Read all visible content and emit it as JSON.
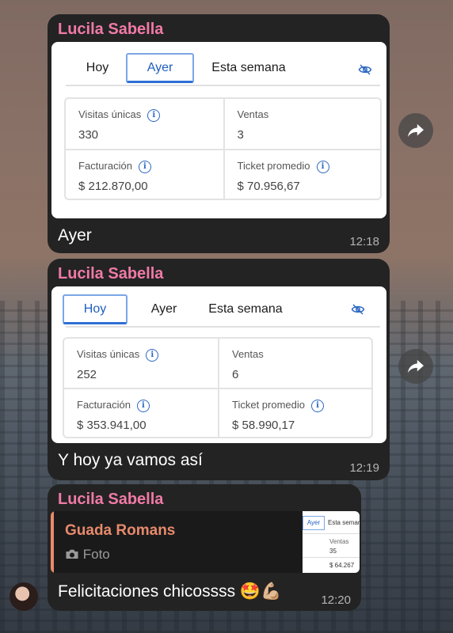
{
  "messages": [
    {
      "sender": "Lucila Sabella",
      "tabs": [
        "Hoy",
        "Ayer",
        "Esta semana"
      ],
      "active_tab": "Ayer",
      "stats": {
        "visitas_label": "Visitas únicas",
        "visitas_value": "330",
        "ventas_label": "Ventas",
        "ventas_value": "3",
        "facturacion_label": "Facturación",
        "facturacion_value": "$ 212.870,00",
        "ticket_label": "Ticket promedio",
        "ticket_value": "$ 70.956,67"
      },
      "text": "Ayer",
      "time": "12:18"
    },
    {
      "sender": "Lucila Sabella",
      "tabs": [
        "Hoy",
        "Ayer",
        "Esta semana"
      ],
      "active_tab": "Hoy",
      "stats": {
        "visitas_label": "Visitas únicas",
        "visitas_value": "252",
        "ventas_label": "Ventas",
        "ventas_value": "6",
        "facturacion_label": "Facturación",
        "facturacion_value": "$ 353.941,00",
        "ticket_label": "Ticket promedio",
        "ticket_value": "$ 58.990,17"
      },
      "text": "Y hoy ya vamos así",
      "time": "12:19"
    },
    {
      "sender": "Lucila Sabella",
      "reply_to": {
        "name": "Guada Romans",
        "subtitle": "Foto",
        "thumb_tab_a": "Ayer",
        "thumb_tab_b": "Esta semana",
        "thumb_ventas": "Ventas",
        "thumb_ventas_val": "35",
        "thumb_amount": "$ 64.267"
      },
      "text": "Felicitaciones chicossss 🤩💪🏼",
      "time": "12:20"
    }
  ],
  "icons": {
    "share": "share-forward-icon",
    "eye": "eye-off-icon",
    "info": "info-icon",
    "camera": "camera-icon"
  },
  "colors": {
    "sender": "#f07aa6",
    "reply_name": "#e78a6c",
    "accent_blue": "#1f5fbf",
    "bubble_bg": "#232323"
  }
}
